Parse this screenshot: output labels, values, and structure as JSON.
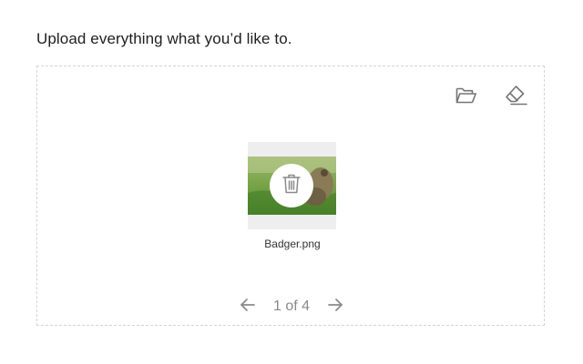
{
  "heading": "Upload everything what you’d like to.",
  "toolbar": {
    "browse_icon": "folder-open-icon",
    "clear_icon": "eraser-icon"
  },
  "file": {
    "name": "Badger.png",
    "delete_icon": "trash-icon"
  },
  "pagination": {
    "label": "1 of 4",
    "prev_icon": "arrow-left-icon",
    "next_icon": "arrow-right-icon"
  },
  "colors": {
    "icon": "#757575",
    "border": "#d4d4d4",
    "card_bg": "#eeeeee",
    "page_text": "#8a8a8a"
  }
}
